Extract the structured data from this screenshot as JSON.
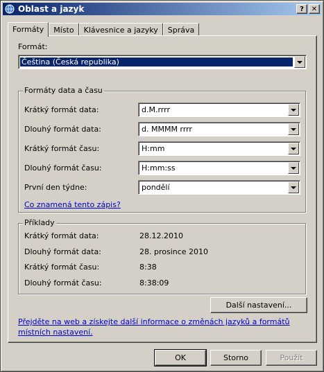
{
  "window": {
    "title": "Oblast a jazyk"
  },
  "tabs": [
    {
      "label": "Formáty",
      "active": true
    },
    {
      "label": "Místo",
      "active": false
    },
    {
      "label": "Klávesnice a jazyky",
      "active": false
    },
    {
      "label": "Správa",
      "active": false
    }
  ],
  "format": {
    "label": "Formát:",
    "value": "Čeština (Česká republika)"
  },
  "datetime_group": {
    "title": "Formáty data a času",
    "rows": [
      {
        "label": "Krátký formát data:",
        "value": "d.M.rrrr"
      },
      {
        "label": "Dlouhý formát data:",
        "value": "d. MMMM rrrr"
      },
      {
        "label": "Krátký formát času:",
        "value": "H:mm"
      },
      {
        "label": "Dlouhý formát času:",
        "value": "H:mm:ss"
      },
      {
        "label": "První den týdne:",
        "value": "pondělí"
      }
    ],
    "help_link": "Co znamená tento zápis?"
  },
  "examples": {
    "title": "Příklady",
    "rows": [
      {
        "label": "Krátký formát data:",
        "value": "28.12.2010"
      },
      {
        "label": "Dlouhý formát data:",
        "value": "28. prosince 2010"
      },
      {
        "label": "Krátký formát času:",
        "value": "8:38"
      },
      {
        "label": "Dlouhý formát času:",
        "value": "8:38:09"
      }
    ]
  },
  "more_settings_button": "Další nastavení...",
  "web_link": {
    "line1": "Přejděte na web a získejte další informace o změnách jazyků a formátů",
    "line2": "místních nastavení."
  },
  "buttons": {
    "ok": "OK",
    "cancel": "Storno",
    "apply": "Použít"
  }
}
